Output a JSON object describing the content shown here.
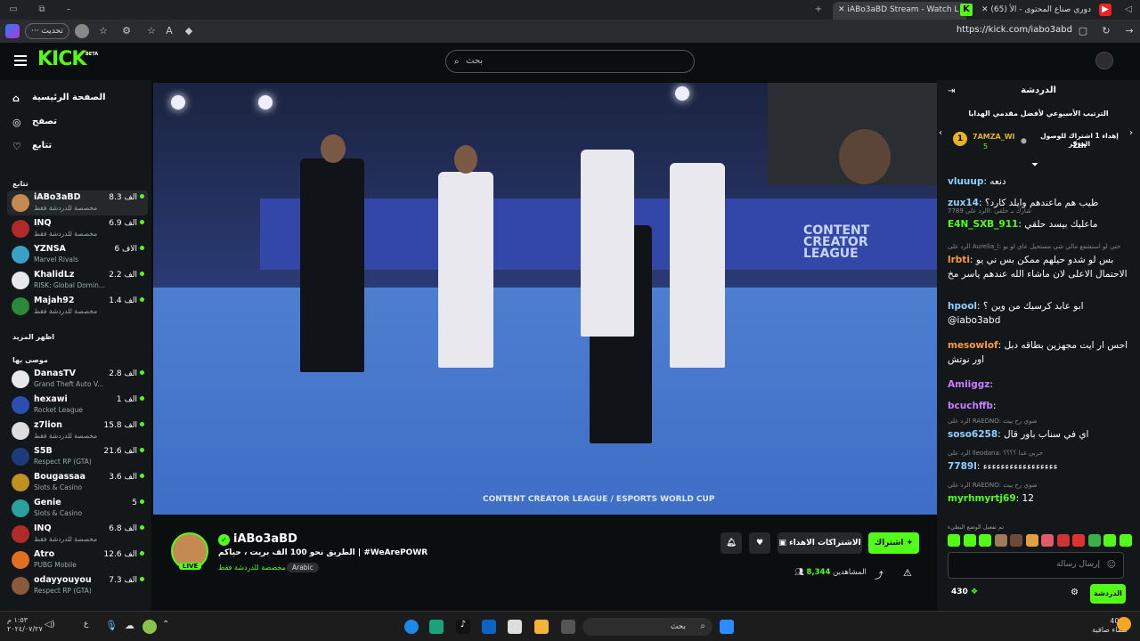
{
  "browser": {
    "tabs": [
      {
        "title": "iABo3aBD Stream - Watch L"
      },
      {
        "title": "(65) دوري صناع المحتوى - الأ"
      }
    ],
    "refresh_label": "تحديث",
    "url": "https://kick.com/iabo3abd"
  },
  "header": {
    "logo": "KICK",
    "beta": "BETA",
    "search_placeholder": "بحث"
  },
  "sidebar": {
    "nav": [
      {
        "label": "الصفحة الرئيسية",
        "icon": "home-icon"
      },
      {
        "label": "تصفح",
        "icon": "compass-icon"
      },
      {
        "label": "تتابع",
        "icon": "heart-icon"
      }
    ],
    "following_title": "تتابع",
    "following": [
      {
        "name": "iABo3aBD",
        "category": "مخصصة للدردشة فقط",
        "viewers": "8.3 الف",
        "color": "#c58a52"
      },
      {
        "name": "INQ",
        "category": "مخصصة للدردشة فقط",
        "viewers": "6.9 الف",
        "color": "#b02a2a"
      },
      {
        "name": "YZNSA",
        "category": "Marvel Rivals",
        "viewers": "6 الاف",
        "color": "#3aa0c8"
      },
      {
        "name": "KhalidLz",
        "category": "RISK: Global Domin...",
        "viewers": "2.2 الف",
        "color": "#e8e8e8"
      },
      {
        "name": "Majah92",
        "category": "مخصصة للدردشة فقط",
        "viewers": "1.4 الف",
        "color": "#2a8a3a"
      }
    ],
    "show_more": "اظهر المزيد",
    "recommended_title": "موصى بها",
    "recommended": [
      {
        "name": "DanasTV",
        "category": "Grand Theft Auto V...",
        "viewers": "2.8 الف",
        "color": "#e8e8e8"
      },
      {
        "name": "hexawi",
        "category": "Rocket League",
        "viewers": "1 الف",
        "color": "#2a4fb0"
      },
      {
        "name": "z7lion",
        "category": "مخصصة للدردشة فقط",
        "viewers": "15.8 الف",
        "color": "#ddd"
      },
      {
        "name": "S5B",
        "category": "Respect RP (GTA)",
        "viewers": "21.6 الف",
        "color": "#1d3a7a"
      },
      {
        "name": "Bougassaa",
        "category": "Slots & Casino",
        "viewers": "3.6 الف",
        "color": "#c09020"
      },
      {
        "name": "Genie",
        "category": "Slots & Casino",
        "viewers": "5",
        "color": "#2aa0a0"
      },
      {
        "name": "INQ",
        "category": "مخصصة للدردشة فقط",
        "viewers": "6.8 الف",
        "color": "#b02a2a"
      },
      {
        "name": "Atro",
        "category": "PUBG Mobile",
        "viewers": "12.6 الف",
        "color": "#e07020"
      },
      {
        "name": "odayyouyou",
        "category": "Respect RP (GTA)",
        "viewers": "7.3 الف",
        "color": "#8a5a3a"
      }
    ]
  },
  "stream": {
    "streamer": "iABo3aBD",
    "title": "الطريق نحو 100 الف بريت ، حياكم | #WeArePOWR",
    "category": "مخصصة للدردشة فقط",
    "language": "Arabic",
    "live": "LIVE",
    "subscribe": "اشتراك",
    "gift_subs": "الاشتراكات الاهداء",
    "viewers_label": "المشاهدين",
    "viewers": "8,344",
    "overlay_league": "CONTENT CREATOR LEAGUE",
    "overlay_footer": "CONTENT CREATOR LEAGUE / ESPORTS WORLD CUP"
  },
  "chat": {
    "title": "الدردشة",
    "leaderboard_title": "الترتيب الأسبوعي لأفضل مقدمي الهدايا",
    "leader_1": {
      "name": "7AMZA_WI",
      "count": "5",
      "rank_text": "إهداء 1 اشتراك للوصول المركز",
      "rank": "2th"
    },
    "messages": [
      {
        "user": "vluuup",
        "color": "#8fd0ff",
        "text": "دنعه"
      },
      {
        "user": "zux14",
        "color": "#8fd0ff",
        "text": "طيب هم ماعندهم وايلد كارد؟"
      },
      {
        "reply": "الرد على 7789l: شارك بـ حلقي",
        "user": "E4N_SXB_911",
        "color": "#53fc18",
        "text": "ماعليك بيسد حلقي"
      },
      {
        "reply": "الرد على Aurelia_l: حتى لو استشفع مالي شي مستحيل عاي لو بو",
        "user": "lrbti",
        "color": "#ff9a3a",
        "text": "بس لو شدو حيلهم ممكن بس ني يو الاحتمال الاعلى لان ماشاء الله عندهم ياسر مخ"
      },
      {
        "user": "hpool",
        "color": "#8fd0ff",
        "text": "ابو عابد كرسيك من وين ؟ @iabo3abd"
      },
      {
        "user": "mesowlof",
        "color": "#ff9a3a",
        "text": "احس ار ايت مجهزين بطاقه دبل اور نوتش"
      },
      {
        "user": "Amiiggz",
        "color": "#c77dff",
        "text": ""
      },
      {
        "user": "bcuchffb",
        "color": "#c77dff",
        "text": ""
      },
      {
        "reply": "الرد على RAEDNO: ضوي رح يبث",
        "user": "soso6258",
        "color": "#8fd0ff",
        "text": "اي في سناب باور قال"
      },
      {
        "reply": "الرد على lleodana: حربي غدا ؟؟؟؟",
        "user": "7789l",
        "color": "#8fd0ff",
        "text": "ءءءءءءءءءءءءءءءءء"
      },
      {
        "reply": "الرد على RAEDNO: ضوي رح يبث",
        "user": "myrhmyrtj69",
        "color": "#53fc18",
        "text": "12"
      }
    ],
    "emote_note": "تم تفعيل الوضع البطيء",
    "input_placeholder": "إرسال رسالة",
    "points": "430",
    "send_label": "الدردشة"
  },
  "taskbar": {
    "search": "بحث",
    "time": "١:٥٣ م",
    "date": "٢٠٢٤/٠٧/٢٧",
    "temp": "40°C",
    "weather": "سماء صافية"
  }
}
